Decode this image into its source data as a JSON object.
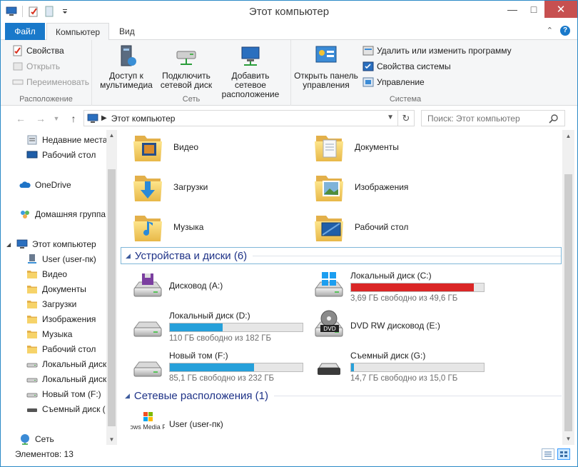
{
  "window": {
    "title": "Этот компьютер"
  },
  "ribbon": {
    "tabs": {
      "file": "Файл",
      "computer": "Компьютер",
      "view": "Вид"
    },
    "location": {
      "label": "Расположение",
      "properties": "Свойства",
      "open": "Открыть",
      "rename": "Переименовать"
    },
    "network": {
      "label": "Сеть",
      "media": "Доступ к\nмультимедиа",
      "map_drive": "Подключить\nсетевой диск",
      "add_location": "Добавить сетевое\nрасположение"
    },
    "system": {
      "label": "Система",
      "control_panel": "Открыть панель\nуправления",
      "uninstall": "Удалить или изменить программу",
      "system_props": "Свойства системы",
      "manage": "Управление"
    }
  },
  "address": {
    "path": "Этот компьютер",
    "search_placeholder": "Поиск: Этот компьютер"
  },
  "nav": {
    "items": [
      {
        "label": "Недавние места",
        "icon": "recent-places-icon"
      },
      {
        "label": "Рабочий стол",
        "icon": "desktop-icon"
      },
      {
        "label": "OneDrive",
        "icon": "onedrive-icon"
      },
      {
        "label": "Домашняя группа",
        "icon": "homegroup-icon"
      },
      {
        "label": "Этот компьютер",
        "icon": "computer-icon"
      },
      {
        "label": "User (user-пк)",
        "icon": "user-network-icon"
      },
      {
        "label": "Видео",
        "icon": "video-folder-icon"
      },
      {
        "label": "Документы",
        "icon": "documents-folder-icon"
      },
      {
        "label": "Загрузки",
        "icon": "downloads-folder-icon"
      },
      {
        "label": "Изображения",
        "icon": "pictures-folder-icon"
      },
      {
        "label": "Музыка",
        "icon": "music-folder-icon"
      },
      {
        "label": "Рабочий стол",
        "icon": "desktop-folder-icon"
      },
      {
        "label": "Локальный диск",
        "icon": "drive-icon"
      },
      {
        "label": "Локальный диск",
        "icon": "drive-icon"
      },
      {
        "label": "Новый том (F:)",
        "icon": "drive-icon"
      },
      {
        "label": "Съемный диск (",
        "icon": "removable-drive-icon"
      },
      {
        "label": "Сеть",
        "icon": "network-icon"
      }
    ]
  },
  "folders": [
    {
      "label": "Видео"
    },
    {
      "label": "Документы"
    },
    {
      "label": "Загрузки"
    },
    {
      "label": "Изображения"
    },
    {
      "label": "Музыка"
    },
    {
      "label": "Рабочий стол"
    }
  ],
  "devices": {
    "header": "Устройства и диски (6)",
    "items": [
      {
        "name": "Дисковод (A:)"
      },
      {
        "name": "Локальный диск (C:)",
        "free": "3,69 ГБ свободно из 49,6 ГБ",
        "used_fraction": 0.926
      },
      {
        "name": "Локальный диск (D:)",
        "free": "110 ГБ свободно из 182 ГБ",
        "used_fraction": 0.396
      },
      {
        "name": "DVD RW дисковод (E:)"
      },
      {
        "name": "Новый том (F:)",
        "free": "85,1 ГБ свободно из 232 ГБ",
        "used_fraction": 0.633
      },
      {
        "name": "Съемный диск (G:)",
        "free": "14,7 ГБ свободно из 15,0 ГБ",
        "used_fraction": 0.02
      }
    ]
  },
  "network_locations": {
    "header": "Сетевые расположения (1)",
    "items": [
      {
        "name": "User (user-пк)",
        "logo_text": "Windows Media Player"
      }
    ]
  },
  "status": {
    "count": "Элементов: 13"
  },
  "colors": {
    "accent": "#1979ca",
    "bar_ok": "#26a0da",
    "bar_full": "#da2626",
    "group_header": "#1e3287"
  }
}
